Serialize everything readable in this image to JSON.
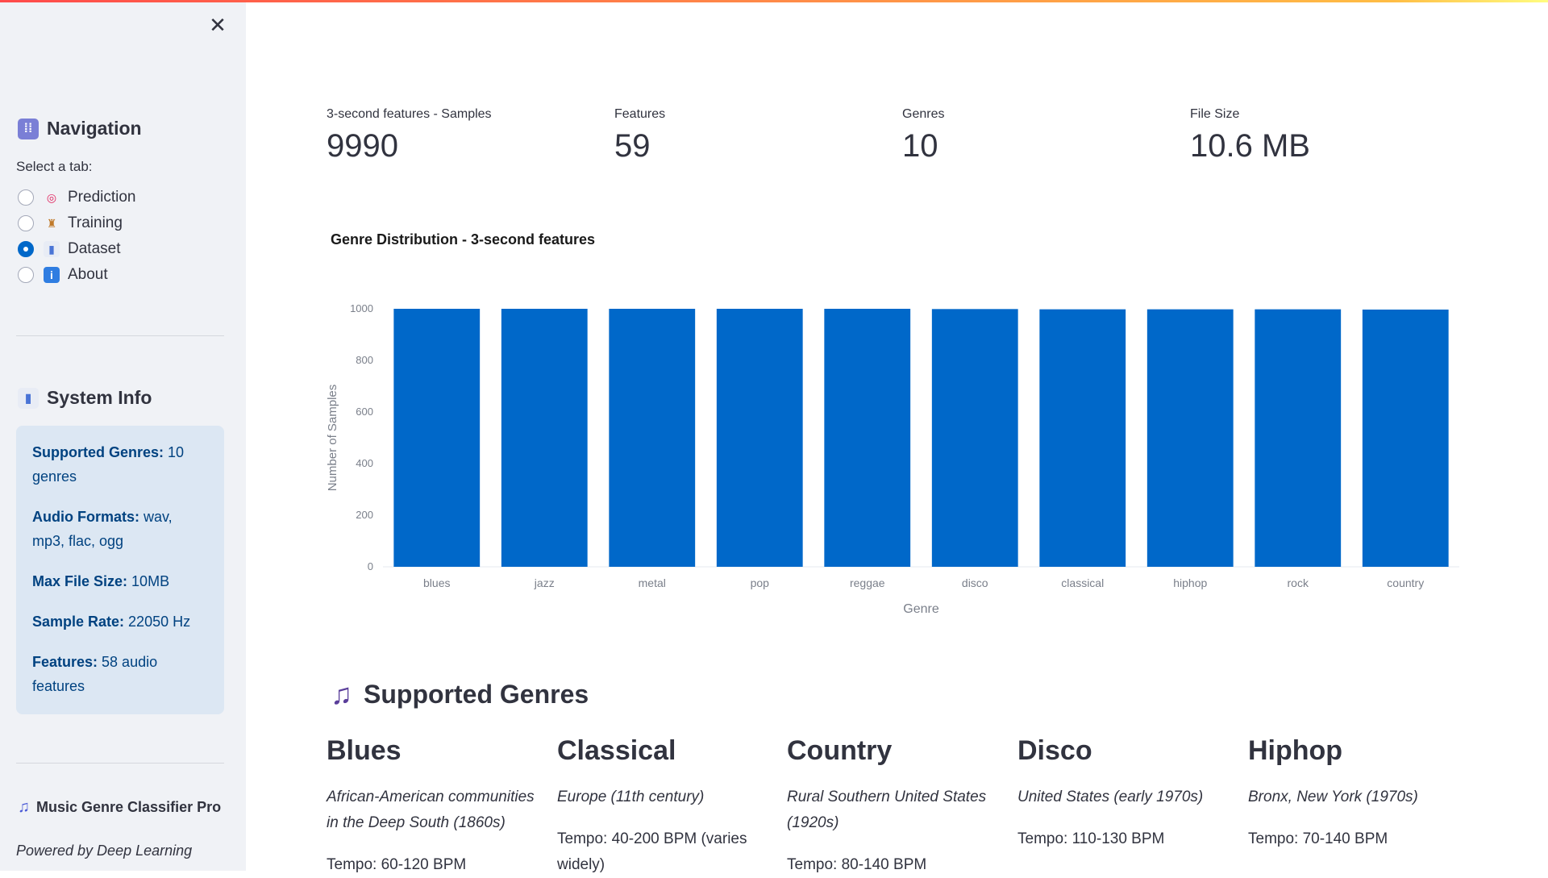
{
  "sidebar": {
    "navigation_title": "Navigation",
    "select_label": "Select a tab:",
    "tabs": [
      {
        "label": "Prediction",
        "icon": "target-icon",
        "selected": false
      },
      {
        "label": "Training",
        "icon": "weightlifter-icon",
        "selected": false
      },
      {
        "label": "Dataset",
        "icon": "bar-chart-icon",
        "selected": true
      },
      {
        "label": "About",
        "icon": "info-icon",
        "selected": false
      }
    ],
    "system_info_title": "System Info",
    "info": [
      {
        "key": "Supported Genres:",
        "value": " 10 genres"
      },
      {
        "key": "Audio Formats:",
        "value": " wav, mp3, flac, ogg"
      },
      {
        "key": "Max File Size:",
        "value": " 10MB"
      },
      {
        "key": "Sample Rate:",
        "value": " 22050 Hz"
      },
      {
        "key": "Features:",
        "value": " 58 audio features"
      }
    ],
    "footer_title": "Music Genre Classifier Pro",
    "footer_subtitle": "Powered by Deep Learning"
  },
  "metrics": [
    {
      "label": "3-second features - Samples",
      "value": "9990"
    },
    {
      "label": "Features",
      "value": "59"
    },
    {
      "label": "Genres",
      "value": "10"
    },
    {
      "label": "File Size",
      "value": "10.6 MB"
    }
  ],
  "chart_title": "Genre Distribution - 3-second features",
  "chart_data": {
    "type": "bar",
    "categories": [
      "blues",
      "jazz",
      "metal",
      "pop",
      "reggae",
      "disco",
      "classical",
      "hiphop",
      "rock",
      "country"
    ],
    "values": [
      1000,
      1000,
      1000,
      1000,
      1000,
      999,
      998,
      998,
      998,
      997
    ],
    "xlabel": "Genre",
    "ylabel": "Number of Samples",
    "ylim": [
      0,
      1000
    ],
    "yticks": [
      0,
      200,
      400,
      600,
      800,
      1000
    ],
    "color": "#0068c9",
    "grid": false
  },
  "genres_section_title": "Supported Genres",
  "genres": [
    {
      "name": "Blues",
      "origin": "African-American communities in the Deep South (1860s)",
      "tempo": "Tempo: 60-120 BPM"
    },
    {
      "name": "Classical",
      "origin": "Europe (11th century)",
      "tempo": "Tempo: 40-200 BPM (varies widely)"
    },
    {
      "name": "Country",
      "origin": "Rural Southern United States (1920s)",
      "tempo": "Tempo: 80-140 BPM"
    },
    {
      "name": "Disco",
      "origin": "United States (early 1970s)",
      "tempo": "Tempo: 110-130 BPM"
    },
    {
      "name": "Hiphop",
      "origin": "Bronx, New York (1970s)",
      "tempo": "Tempo: 70-140 BPM"
    }
  ]
}
